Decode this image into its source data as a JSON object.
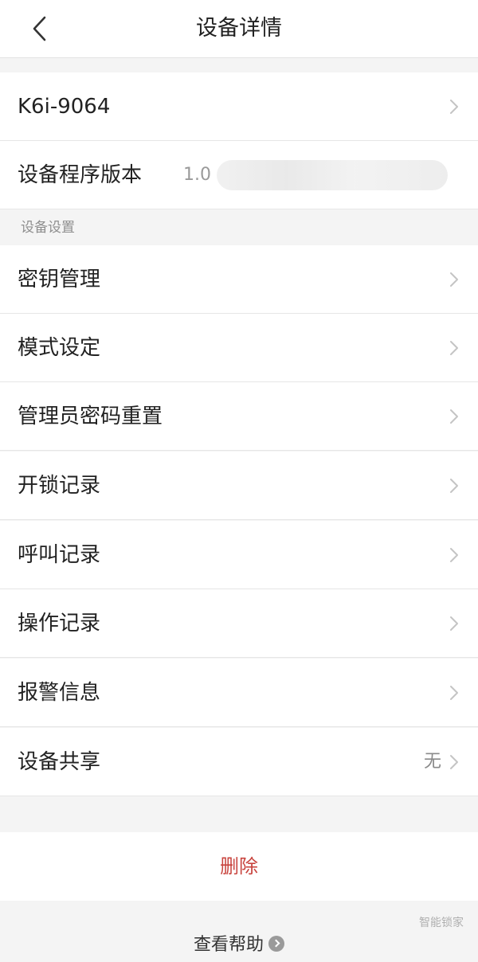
{
  "header": {
    "title": "设备详情",
    "back_icon": "chevron-left-icon"
  },
  "device": {
    "name": "K6i-9064",
    "version_label": "设备程序版本",
    "version_value": "1.0"
  },
  "section": {
    "title": "设备设置"
  },
  "settings": [
    {
      "label": "密钥管理"
    },
    {
      "label": "模式设定"
    },
    {
      "label": "管理员密码重置"
    },
    {
      "label": "开锁记录"
    },
    {
      "label": "呼叫记录"
    },
    {
      "label": "操作记录"
    },
    {
      "label": "报警信息"
    },
    {
      "label": "设备共享",
      "value": "无"
    }
  ],
  "actions": {
    "delete_label": "删除",
    "help_label": "查看帮助"
  },
  "watermark": {
    "text": "智能锁家"
  },
  "colors": {
    "accent_delete": "#c8433d",
    "background": "#f4f4f4",
    "card": "#ffffff"
  }
}
